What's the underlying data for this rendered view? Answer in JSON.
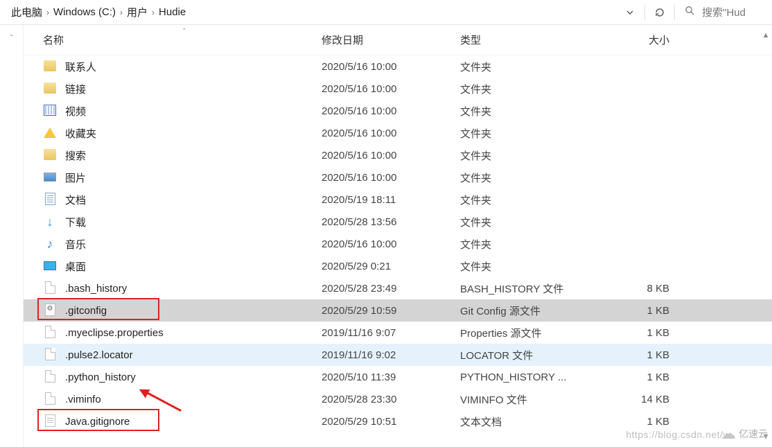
{
  "breadcrumbs": [
    "此电脑",
    "Windows (C:)",
    "用户",
    "Hudie"
  ],
  "search_placeholder": "搜索\"Hud",
  "columns": {
    "name": "名称",
    "date": "修改日期",
    "type": "类型",
    "size": "大小"
  },
  "rows": [
    {
      "icon": "contacts-icon",
      "name": "联系人",
      "date": "2020/5/16 10:00",
      "type": "文件夹",
      "size": ""
    },
    {
      "icon": "links-icon",
      "name": "链接",
      "date": "2020/5/16 10:00",
      "type": "文件夹",
      "size": ""
    },
    {
      "icon": "video-icon",
      "name": "视频",
      "date": "2020/5/16 10:00",
      "type": "文件夹",
      "size": ""
    },
    {
      "icon": "favorites-icon",
      "name": "收藏夹",
      "date": "2020/5/16 10:00",
      "type": "文件夹",
      "size": ""
    },
    {
      "icon": "search-folder-icon",
      "name": "搜索",
      "date": "2020/5/16 10:00",
      "type": "文件夹",
      "size": ""
    },
    {
      "icon": "pictures-icon",
      "name": "图片",
      "date": "2020/5/16 10:00",
      "type": "文件夹",
      "size": ""
    },
    {
      "icon": "documents-icon",
      "name": "文档",
      "date": "2020/5/19 18:11",
      "type": "文件夹",
      "size": ""
    },
    {
      "icon": "downloads-icon",
      "name": "下载",
      "date": "2020/5/28 13:56",
      "type": "文件夹",
      "size": ""
    },
    {
      "icon": "music-icon",
      "name": "音乐",
      "date": "2020/5/16 10:00",
      "type": "文件夹",
      "size": ""
    },
    {
      "icon": "desktop-icon",
      "name": "桌面",
      "date": "2020/5/29 0:21",
      "type": "文件夹",
      "size": ""
    },
    {
      "icon": "file-icon",
      "name": ".bash_history",
      "date": "2020/5/28 23:49",
      "type": "BASH_HISTORY 文件",
      "size": "8 KB"
    },
    {
      "icon": "gear-file-icon",
      "name": ".gitconfig",
      "date": "2020/5/29 10:59",
      "type": "Git Config 源文件",
      "size": "1 KB"
    },
    {
      "icon": "file-icon",
      "name": ".myeclipse.properties",
      "date": "2019/11/16 9:07",
      "type": "Properties 源文件",
      "size": "1 KB"
    },
    {
      "icon": "file-icon",
      "name": ".pulse2.locator",
      "date": "2019/11/16 9:02",
      "type": "LOCATOR 文件",
      "size": "1 KB"
    },
    {
      "icon": "file-icon",
      "name": ".python_history",
      "date": "2020/5/10 11:39",
      "type": "PYTHON_HISTORY ...",
      "size": "1 KB"
    },
    {
      "icon": "file-icon",
      "name": ".viminfo",
      "date": "2020/5/28 23:30",
      "type": "VIMINFO 文件",
      "size": "14 KB"
    },
    {
      "icon": "text-file-icon",
      "name": "Java.gitignore",
      "date": "2020/5/29 10:51",
      "type": "文本文档",
      "size": "1 KB"
    }
  ],
  "selected_index": 11,
  "hover_index": 13,
  "highlight_boxes": [
    11,
    16
  ],
  "watermark": "https://blog.csdn.net/w",
  "brand": "亿速云"
}
